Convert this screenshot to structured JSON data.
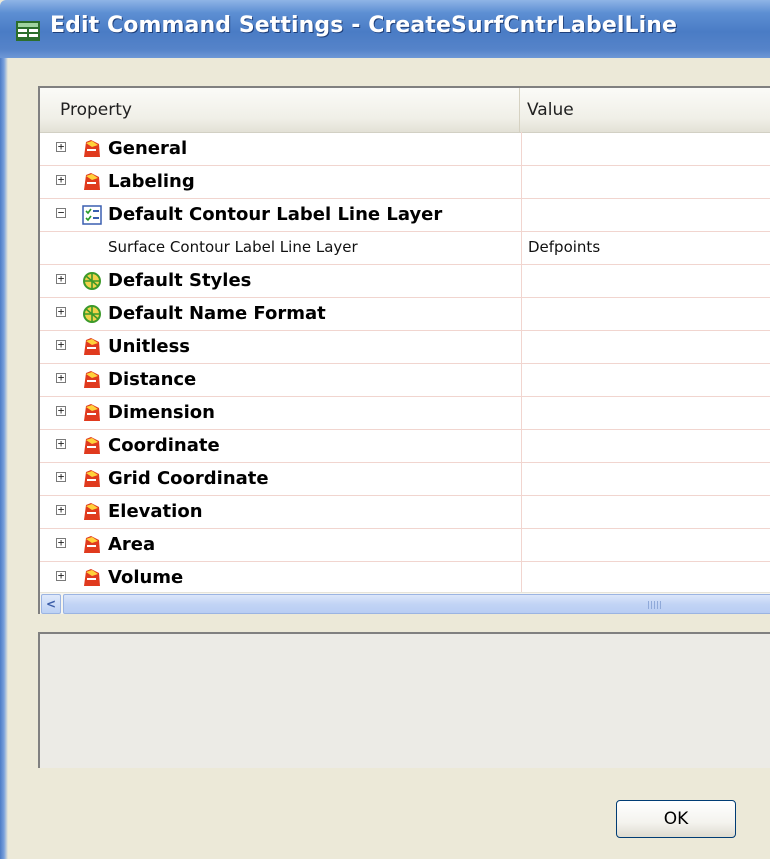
{
  "window": {
    "title": "Edit Command Settings - CreateSurfCntrLabelLine"
  },
  "grid": {
    "column_property": "Property",
    "column_value": "Value",
    "rows": [
      {
        "type": "category",
        "label": "General",
        "expander": "+",
        "icon": "settings-folder-icon"
      },
      {
        "type": "category",
        "label": "Labeling",
        "expander": "+",
        "icon": "settings-folder-icon"
      },
      {
        "type": "category",
        "label": "Default Contour Label Line Layer",
        "expander": "−",
        "icon": "layer-checklist-icon"
      },
      {
        "type": "property",
        "label": "Surface Contour Label Line Layer",
        "value": "Defpoints"
      },
      {
        "type": "category",
        "label": "Default Styles",
        "expander": "+",
        "icon": "style-globe-icon"
      },
      {
        "type": "category",
        "label": "Default Name Format",
        "expander": "+",
        "icon": "style-globe-icon"
      },
      {
        "type": "category",
        "label": "Unitless",
        "expander": "+",
        "icon": "settings-folder-icon"
      },
      {
        "type": "category",
        "label": "Distance",
        "expander": "+",
        "icon": "settings-folder-icon"
      },
      {
        "type": "category",
        "label": "Dimension",
        "expander": "+",
        "icon": "settings-folder-icon"
      },
      {
        "type": "category",
        "label": "Coordinate",
        "expander": "+",
        "icon": "settings-folder-icon"
      },
      {
        "type": "category",
        "label": "Grid Coordinate",
        "expander": "+",
        "icon": "settings-folder-icon"
      },
      {
        "type": "category",
        "label": "Elevation",
        "expander": "+",
        "icon": "settings-folder-icon"
      },
      {
        "type": "category",
        "label": "Area",
        "expander": "+",
        "icon": "settings-folder-icon"
      },
      {
        "type": "category",
        "label": "Volume",
        "expander": "+",
        "icon": "settings-folder-icon"
      }
    ]
  },
  "scrollbar": {
    "left_arrow": "<"
  },
  "buttons": {
    "ok_label": "OK"
  },
  "colors": {
    "titlebar": "#4a7cc5",
    "dialog_bg": "#ece9d8",
    "row_separator": "#f1d5cf"
  }
}
